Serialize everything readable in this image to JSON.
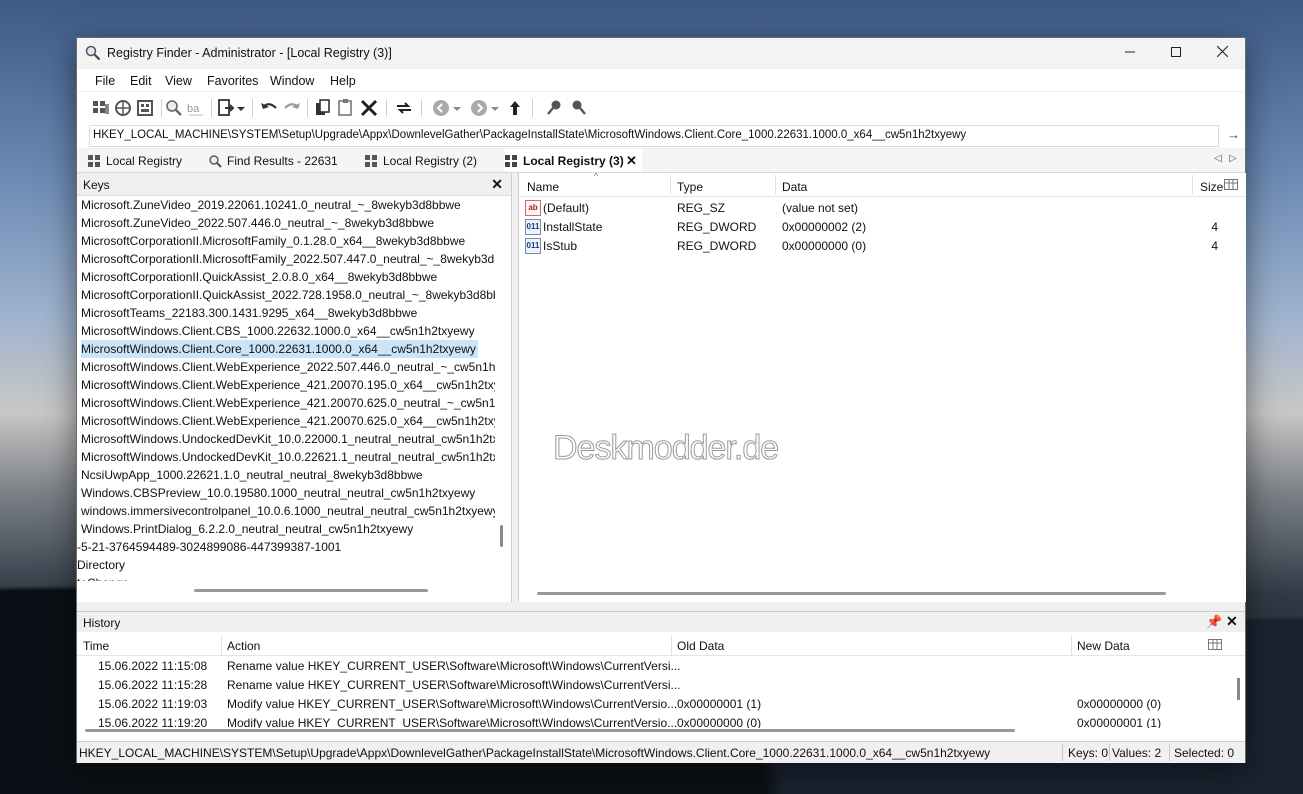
{
  "window": {
    "title": "Registry Finder - Administrator - [Local Registry (3)]"
  },
  "menu": [
    "File",
    "Edit",
    "View",
    "Favorites",
    "Window",
    "Help"
  ],
  "address": {
    "path": "HKEY_LOCAL_MACHINE\\SYSTEM\\Setup\\Upgrade\\Appx\\DownlevelGather\\PackageInstallState\\MicrosoftWindows.Client.Core_1000.22631.1000.0_x64__cw5n1h2txyewy"
  },
  "tabs": [
    {
      "label": "Local Registry"
    },
    {
      "label": "Find Results - 22631"
    },
    {
      "label": "Local Registry (2)"
    },
    {
      "label": "Local Registry (3)"
    }
  ],
  "keys_panel": {
    "title": "Keys",
    "items": [
      "Microsoft.ZuneVideo_2019.22061.10241.0_neutral_~_8wekyb3d8bbwe",
      "Microsoft.ZuneVideo_2022.507.446.0_neutral_~_8wekyb3d8bbwe",
      "MicrosoftCorporationII.MicrosoftFamily_0.1.28.0_x64__8wekyb3d8bbwe",
      "MicrosoftCorporationII.MicrosoftFamily_2022.507.447.0_neutral_~_8wekyb3d8bb",
      "MicrosoftCorporationII.QuickAssist_2.0.8.0_x64__8wekyb3d8bbwe",
      "MicrosoftCorporationII.QuickAssist_2022.728.1958.0_neutral_~_8wekyb3d8bbw",
      "MicrosoftTeams_22183.300.1431.9295_x64__8wekyb3d8bbwe",
      "MicrosoftWindows.Client.CBS_1000.22632.1000.0_x64__cw5n1h2txyewy",
      "MicrosoftWindows.Client.Core_1000.22631.1000.0_x64__cw5n1h2txyewy",
      "MicrosoftWindows.Client.WebExperience_2022.507.446.0_neutral_~_cw5n1h2tx",
      "MicrosoftWindows.Client.WebExperience_421.20070.195.0_x64__cw5n1h2txyew",
      "MicrosoftWindows.Client.WebExperience_421.20070.625.0_neutral_~_cw5n1h2t",
      "MicrosoftWindows.Client.WebExperience_421.20070.625.0_x64__cw5n1h2txyew",
      "MicrosoftWindows.UndockedDevKit_10.0.22000.1_neutral_neutral_cw5n1h2txy",
      "MicrosoftWindows.UndockedDevKit_10.0.22621.1_neutral_neutral_cw5n1h2txy",
      "NcsiUwpApp_1000.22621.1.0_neutral_neutral_8wekyb3d8bbwe",
      "Windows.CBSPreview_10.0.19580.1000_neutral_neutral_cw5n1h2txyewy",
      "windows.immersivecontrolpanel_10.0.6.1000_neutral_neutral_cw5n1h2txyewy",
      "Windows.PrintDialog_6.2.2.0_neutral_neutral_cw5n1h2txyewy",
      "-5-21-3764594489-3024899086-447399387-1001",
      "Directory",
      "teChange"
    ],
    "selected_index": 8
  },
  "values_panel": {
    "columns": {
      "name": "Name",
      "type": "Type",
      "data": "Data",
      "size": "Size"
    },
    "rows": [
      {
        "icon": "ab",
        "name": "(Default)",
        "type": "REG_SZ",
        "data": "(value not set)",
        "size": ""
      },
      {
        "icon": "bin",
        "name": "InstallState",
        "type": "REG_DWORD",
        "data": "0x00000002 (2)",
        "size": "4"
      },
      {
        "icon": "bin",
        "name": "IsStub",
        "type": "REG_DWORD",
        "data": "0x00000000 (0)",
        "size": "4"
      }
    ],
    "watermark": "Deskmodder.de"
  },
  "history": {
    "title": "History",
    "columns": {
      "time": "Time",
      "action": "Action",
      "old": "Old Data",
      "new": "New Data"
    },
    "rows": [
      {
        "time": "15.06.2022 11:15:08",
        "action": "Rename value HKEY_CURRENT_USER\\Software\\Microsoft\\Windows\\CurrentVersi...",
        "old": "",
        "new": ""
      },
      {
        "time": "15.06.2022 11:15:28",
        "action": "Rename value HKEY_CURRENT_USER\\Software\\Microsoft\\Windows\\CurrentVersi...",
        "old": "",
        "new": ""
      },
      {
        "time": "15.06.2022 11:19:03",
        "action": "Modify value HKEY_CURRENT_USER\\Software\\Microsoft\\Windows\\CurrentVersio...",
        "old": "0x00000001 (1)",
        "new": "0x00000000 (0)"
      },
      {
        "time": "15.06.2022 11:19:20",
        "action": "Modify value HKEY_CURRENT_USER\\Software\\Microsoft\\Windows\\CurrentVersio...",
        "old": "0x00000000 (0)",
        "new": "0x00000001 (1)"
      }
    ]
  },
  "status": {
    "path": "HKEY_LOCAL_MACHINE\\SYSTEM\\Setup\\Upgrade\\Appx\\DownlevelGather\\PackageInstallState\\MicrosoftWindows.Client.Core_1000.22631.1000.0_x64__cw5n1h2txyewy",
    "keys": "Keys: 0",
    "values": "Values: 2",
    "selected": "Selected: 0"
  },
  "colors": {
    "selection": "#cce4f7",
    "accent": "#2f5fb3"
  }
}
